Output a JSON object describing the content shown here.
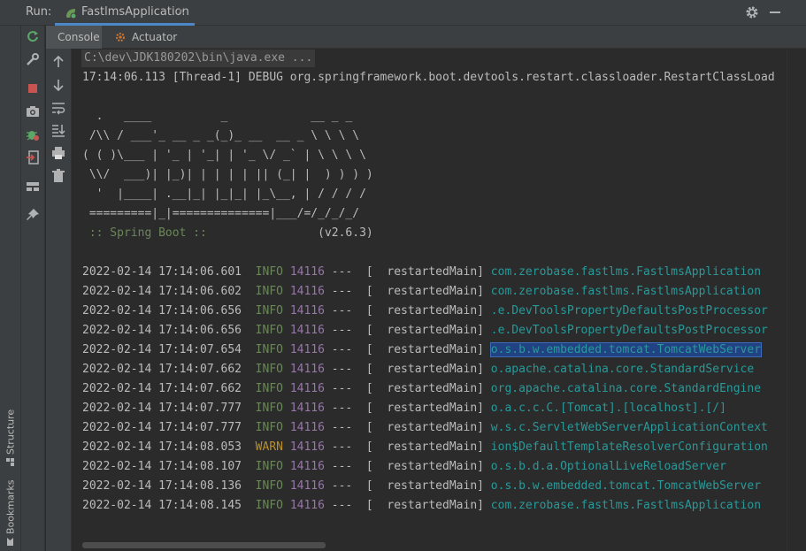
{
  "run_bar": {
    "label": "Run:",
    "tab_label": "FastlmsApplication",
    "close_glyph": "×"
  },
  "side_labels": {
    "structure": "Structure",
    "bookmarks": "Bookmarks"
  },
  "sub_tabs": [
    {
      "label": "Console",
      "active": true
    },
    {
      "label": "Actuator",
      "active": false
    }
  ],
  "console": {
    "cmd_line": "C:\\dev\\JDK180202\\bin\\java.exe ...",
    "debug_line": "17:14:06.113 [Thread-1] DEBUG org.springframework.boot.devtools.restart.classloader.RestartClassLoad",
    "banner": [
      "  .   ____          _            __ _ _",
      " /\\\\ / ___'_ __ _ _(_)_ __  __ _ \\ \\ \\ \\",
      "( ( )\\___ | '_ | '_| | '_ \\/ _` | \\ \\ \\ \\",
      " \\\\/  ___)| |_)| | | | | || (_| |  ) ) ) )",
      "  '  |____| .__|_| |_|_| |_\\__, | / / / /",
      " =========|_|==============|___/=/_/_/_/"
    ],
    "spring_label": " :: Spring Boot :: ",
    "spring_version": "               (v2.6.3)",
    "logs": [
      {
        "ts": "2022-02-14 17:14:06.601",
        "level": "INFO",
        "pid": "14116",
        "thread": "---  [  restartedMain]",
        "logger": "com.zerobase.fastlms.FastlmsApplication"
      },
      {
        "ts": "2022-02-14 17:14:06.602",
        "level": "INFO",
        "pid": "14116",
        "thread": "---  [  restartedMain]",
        "logger": "com.zerobase.fastlms.FastlmsApplication"
      },
      {
        "ts": "2022-02-14 17:14:06.656",
        "level": "INFO",
        "pid": "14116",
        "thread": "---  [  restartedMain]",
        "logger": ".e.DevToolsPropertyDefaultsPostProcessor"
      },
      {
        "ts": "2022-02-14 17:14:06.656",
        "level": "INFO",
        "pid": "14116",
        "thread": "---  [  restartedMain]",
        "logger": ".e.DevToolsPropertyDefaultsPostProcessor"
      },
      {
        "ts": "2022-02-14 17:14:07.654",
        "level": "INFO",
        "pid": "14116",
        "thread": "---  [  restartedMain]",
        "logger": "o.s.b.w.embedded.tomcat.TomcatWebServer",
        "selected": true
      },
      {
        "ts": "2022-02-14 17:14:07.662",
        "level": "INFO",
        "pid": "14116",
        "thread": "---  [  restartedMain]",
        "logger": "o.apache.catalina.core.StandardService"
      },
      {
        "ts": "2022-02-14 17:14:07.662",
        "level": "INFO",
        "pid": "14116",
        "thread": "---  [  restartedMain]",
        "logger": "org.apache.catalina.core.StandardEngine"
      },
      {
        "ts": "2022-02-14 17:14:07.777",
        "level": "INFO",
        "pid": "14116",
        "thread": "---  [  restartedMain]",
        "logger": "o.a.c.c.C.[Tomcat].[localhost].[/]"
      },
      {
        "ts": "2022-02-14 17:14:07.777",
        "level": "INFO",
        "pid": "14116",
        "thread": "---  [  restartedMain]",
        "logger": "w.s.c.ServletWebServerApplicationContext"
      },
      {
        "ts": "2022-02-14 17:14:08.053",
        "level": "WARN",
        "pid": "14116",
        "thread": "---  [  restartedMain]",
        "logger": "ion$DefaultTemplateResolverConfiguration"
      },
      {
        "ts": "2022-02-14 17:14:08.107",
        "level": "INFO",
        "pid": "14116",
        "thread": "---  [  restartedMain]",
        "logger": "o.s.b.d.a.OptionalLiveReloadServer"
      },
      {
        "ts": "2022-02-14 17:14:08.136",
        "level": "INFO",
        "pid": "14116",
        "thread": "---  [  restartedMain]",
        "logger": "o.s.b.w.embedded.tomcat.TomcatWebServer"
      },
      {
        "ts": "2022-02-14 17:14:08.145",
        "level": "INFO",
        "pid": "14116",
        "thread": "---  [  restartedMain]",
        "logger": "com.zerobase.fastlms.FastlmsApplication"
      }
    ]
  },
  "colors": {
    "background": "#2b2b2b",
    "panel": "#3c3f41",
    "info": "#6a8759",
    "warn": "#bb8f2b",
    "pid": "#9876aa",
    "logger": "#299999",
    "selection": "#214283",
    "tab_underline": "#4a88c7"
  },
  "icons": {
    "run_tab": "spring-boot-icon",
    "settings": "gear-icon",
    "hide": "minimize-icon",
    "toolbar_left": [
      "rerun-icon",
      "wrench-icon",
      "stop-icon",
      "camera-icon",
      "debug-bug-icon",
      "exit-icon",
      "layout-icon",
      "pin-icon"
    ],
    "toolbar_console": [
      "up-arrow-icon",
      "down-arrow-icon",
      "soft-wrap-icon",
      "scroll-to-end-icon",
      "print-icon",
      "trash-icon"
    ]
  }
}
